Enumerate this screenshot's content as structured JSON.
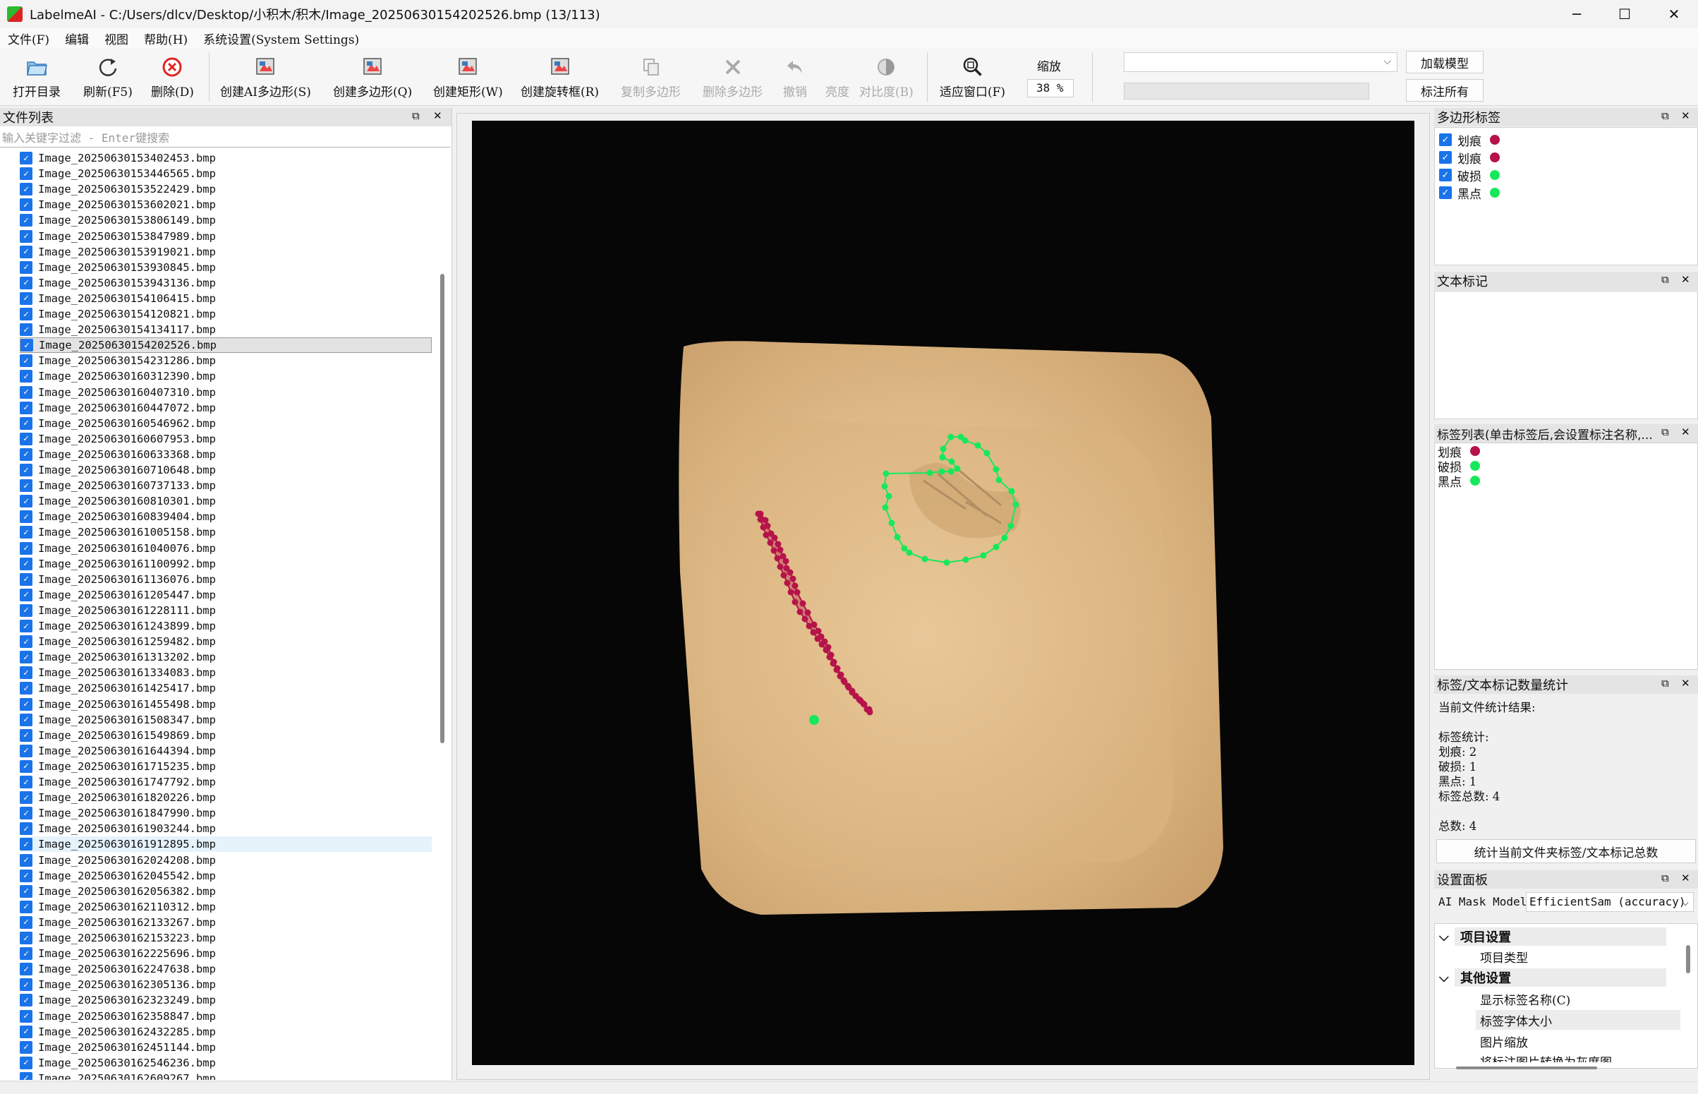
{
  "window": {
    "title": "LabelmeAI - C:/Users/dlcv/Desktop/小积木/积木/Image_20250630154202526.bmp (13/113)",
    "minimize": "─",
    "maximize": "☐",
    "close": "✕"
  },
  "menu": [
    "文件(F)",
    "编辑",
    "视图",
    "帮助(H)",
    "系统设置(System Settings)"
  ],
  "toolbar": {
    "open_dir": "打开目录",
    "refresh": "刷新(F5)",
    "delete": "删除(D)",
    "create_ai_polygon": "创建AI多边形(S)",
    "create_polygon": "创建多边形(Q)",
    "create_rect": "创建矩形(W)",
    "create_rotated_box": "创建旋转框(R)",
    "copy_polygon": "复制多边形",
    "delete_polygon": "删除多边形",
    "undo": "撤销",
    "brightness": "亮度",
    "contrast": "对比度(B)",
    "fit_window": "适应窗口(F)",
    "zoom_label": "缩放",
    "zoom_value": "38 %",
    "load_model": "加载模型",
    "label_all": "标注所有"
  },
  "file_panel": {
    "title": "文件列表",
    "filter_placeholder": "输入关键字过滤 - Enter键搜索",
    "files": [
      "Image_20250630153402453.bmp",
      "Image_20250630153446565.bmp",
      "Image_20250630153522429.bmp",
      "Image_20250630153602021.bmp",
      "Image_20250630153806149.bmp",
      "Image_20250630153847989.bmp",
      "Image_20250630153919021.bmp",
      "Image_20250630153930845.bmp",
      "Image_20250630153943136.bmp",
      "Image_20250630154106415.bmp",
      "Image_20250630154120821.bmp",
      "Image_20250630154134117.bmp",
      "Image_20250630154202526.bmp",
      "Image_20250630154231286.bmp",
      "Image_20250630160312390.bmp",
      "Image_20250630160407310.bmp",
      "Image_20250630160447072.bmp",
      "Image_20250630160546962.bmp",
      "Image_20250630160607953.bmp",
      "Image_20250630160633368.bmp",
      "Image_20250630160710648.bmp",
      "Image_20250630160737133.bmp",
      "Image_20250630160810301.bmp",
      "Image_20250630160839404.bmp",
      "Image_20250630161005158.bmp",
      "Image_20250630161040076.bmp",
      "Image_20250630161100992.bmp",
      "Image_20250630161136076.bmp",
      "Image_20250630161205447.bmp",
      "Image_20250630161228111.bmp",
      "Image_20250630161243899.bmp",
      "Image_20250630161259482.bmp",
      "Image_20250630161313202.bmp",
      "Image_20250630161334083.bmp",
      "Image_20250630161425417.bmp",
      "Image_20250630161455498.bmp",
      "Image_20250630161508347.bmp",
      "Image_20250630161549869.bmp",
      "Image_20250630161644394.bmp",
      "Image_20250630161715235.bmp",
      "Image_20250630161747792.bmp",
      "Image_20250630161820226.bmp",
      "Image_20250630161847990.bmp",
      "Image_20250630161903244.bmp",
      "Image_20250630161912895.bmp",
      "Image_20250630162024208.bmp",
      "Image_20250630162045542.bmp",
      "Image_20250630162056382.bmp",
      "Image_20250630162110312.bmp",
      "Image_20250630162133267.bmp",
      "Image_20250630162153223.bmp",
      "Image_20250630162225696.bmp",
      "Image_20250630162247638.bmp",
      "Image_20250630162305136.bmp",
      "Image_20250630162323249.bmp",
      "Image_20250630162358847.bmp",
      "Image_20250630162432285.bmp",
      "Image_20250630162451144.bmp",
      "Image_20250630162546236.bmp",
      "Image_20250630162609267.bmp"
    ],
    "selected_index": 12,
    "hover_index": 44
  },
  "polygon_labels": {
    "title": "多边形标签",
    "items": [
      {
        "name": "划痕",
        "color": "#b5134a"
      },
      {
        "name": "划痕",
        "color": "#b5134a"
      },
      {
        "name": "破损",
        "color": "#17e85a"
      },
      {
        "name": "黑点",
        "color": "#17e85a"
      }
    ]
  },
  "text_marks": {
    "title": "文本标记"
  },
  "label_list": {
    "title": "标签列表(单击标签后,会设置标注名称,...",
    "items": [
      {
        "name": "划痕",
        "color": "#b5134a"
      },
      {
        "name": "破损",
        "color": "#17e85a"
      },
      {
        "name": "黑点",
        "color": "#17e85a"
      }
    ]
  },
  "stats": {
    "title": "标签/文本标记数量统计",
    "lines": [
      "当前文件统计结果:",
      "",
      "标签统计:",
      "划痕: 2",
      "破损: 1",
      "黑点: 1",
      "标签总数: 4",
      "",
      "总数: 4"
    ],
    "button": "统计当前文件夹标签/文本标记总数"
  },
  "settings": {
    "title": "设置面板",
    "mask_model_label": "AI Mask Model",
    "mask_model_value": "EfficientSam (accuracy)",
    "tree": [
      {
        "text": "项目设置",
        "section": true
      },
      {
        "text": "项目类型",
        "section": false
      },
      {
        "text": "其他设置",
        "section": true
      },
      {
        "text": "显示标签名称(C)",
        "section": false
      },
      {
        "text": "标签字体大小",
        "section": false
      },
      {
        "text": "图片缩放",
        "section": false
      },
      {
        "text": "将标注图片转换为灰度图",
        "section": false
      }
    ]
  },
  "colors": {
    "scratch": "#b5134a",
    "damage": "#17e85a",
    "accent": "#1a73e8"
  }
}
